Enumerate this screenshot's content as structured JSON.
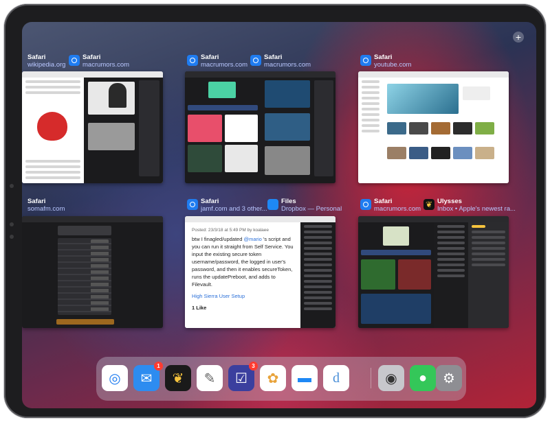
{
  "top_right_button": {
    "icon": "plus-circle-icon",
    "glyph": "+"
  },
  "apps": [
    {
      "title": "Safari",
      "subtitle": "wikipedia.org",
      "icon": "safari-icon"
    },
    {
      "title": "Safari",
      "subtitle": "macrumors.com",
      "icon": "safari-icon"
    },
    {
      "title": "Safari",
      "subtitle": "macrumors.com",
      "icon": "safari-icon"
    },
    {
      "title": "Safari",
      "subtitle": "macrumors.com",
      "icon": "safari-icon"
    },
    {
      "title": "Safari",
      "subtitle": "youtube.com",
      "icon": "safari-icon"
    },
    {
      "title": "Safari",
      "subtitle": "somafm.com",
      "icon": "safari-icon"
    },
    {
      "title": "Safari",
      "subtitle": "jamf.com and 3 other...",
      "icon": "safari-icon"
    },
    {
      "title": "Files",
      "subtitle": "Dropbox — Personal",
      "icon": "files-icon"
    },
    {
      "title": "Safari",
      "subtitle": "macrumors.com",
      "icon": "safari-icon"
    },
    {
      "title": "Ulysses",
      "subtitle": "Inbox • Apple's newest ra...",
      "icon": "ulysses-icon"
    }
  ],
  "jamf_post": {
    "meta": "Posted: 23/3/18 at 5:49 PM by koalaee",
    "text_a": "btw I finagled/updated",
    "mention": "@mario",
    "text_b": "'s script and you can run it straight from Self Service. You input the existing secure token username/password, the logged in user's password, and then it enables secureToken, runs the updatePreboot, and adds to Filevault.",
    "link": "High Sierra User Setup",
    "likes": "1 Like"
  },
  "dock": [
    {
      "name": "safari",
      "icon": "safari-icon",
      "badge": "",
      "color": "#ffffff"
    },
    {
      "name": "mail",
      "icon": "mail-icon",
      "badge": "1",
      "color": "#2d8cf0"
    },
    {
      "name": "ulysses",
      "icon": "butterfly-icon",
      "badge": "",
      "color": "#1a1a1a"
    },
    {
      "name": "editorial",
      "icon": "pen-icon",
      "badge": "",
      "color": "#ffffff"
    },
    {
      "name": "omnifocus",
      "icon": "checkbox-icon",
      "badge": "3",
      "color": "#3b3f9e"
    },
    {
      "name": "photos",
      "icon": "photos-icon",
      "badge": "",
      "color": "#ffffff"
    },
    {
      "name": "files",
      "icon": "folder-icon",
      "badge": "",
      "color": "#ffffff"
    },
    {
      "name": "dictionary",
      "icon": "letter-d-icon",
      "badge": "",
      "color": "#ffffff"
    },
    {
      "name": "camera",
      "icon": "camera-icon",
      "badge": "",
      "color": "#8e8e93"
    },
    {
      "name": "messages",
      "icon": "speech-bubble-icon",
      "badge": "",
      "color": "#34c759"
    },
    {
      "name": "settings",
      "icon": "gear-icon",
      "badge": "",
      "color": "#8e8e93"
    }
  ],
  "dock_glyphs": {
    "safari": "◎",
    "mail": "✉",
    "ulysses": "❦",
    "editorial": "✎",
    "omnifocus": "☑",
    "photos": "✿",
    "files": "▬",
    "dictionary": "d",
    "camera": "◉",
    "messages": "●",
    "settings": "⚙"
  }
}
